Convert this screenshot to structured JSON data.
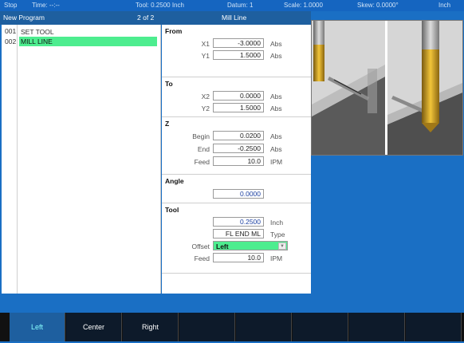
{
  "statusbar": {
    "state": "Stop",
    "time": "Time:  --:--",
    "tool": "Tool: 0.2500 Inch",
    "datum": "Datum: 1",
    "scale": "Scale: 1.0000",
    "skew": "Skew: 0.0000°",
    "units": "Inch"
  },
  "titlebar": {
    "program": "New Program",
    "page": "2 of 2",
    "step_title": "Mill Line"
  },
  "program_list": [
    {
      "num": "001",
      "label": "SET TOOL",
      "selected": false
    },
    {
      "num": "002",
      "label": "MILL LINE",
      "selected": true
    }
  ],
  "form": {
    "from": {
      "heading": "From",
      "x_label": "X1",
      "x_value": "-3.0000",
      "x_unit": "Abs",
      "y_label": "Y1",
      "y_value": "1.5000",
      "y_unit": "Abs"
    },
    "to": {
      "heading": "To",
      "x_label": "X2",
      "x_value": "0.0000",
      "x_unit": "Abs",
      "y_label": "Y2",
      "y_value": "1.5000",
      "y_unit": "Abs"
    },
    "z": {
      "heading": "Z",
      "begin_label": "Begin",
      "begin_value": "0.0200",
      "begin_unit": "Abs",
      "end_label": "End",
      "end_value": "-0.2500",
      "end_unit": "Abs",
      "feed_label": "Feed",
      "feed_value": "10.0",
      "feed_unit": "IPM"
    },
    "angle": {
      "heading": "Angle",
      "value": "0.0000"
    },
    "tool": {
      "heading": "Tool",
      "diameter_value": "0.2500",
      "diameter_unit": "Inch",
      "type_value": "FL END ML",
      "type_unit": "Type",
      "offset_label": "Offset",
      "offset_value": "Left",
      "feed_label": "Feed",
      "feed_value": "10.0",
      "feed_unit": "IPM"
    }
  },
  "softkeys": [
    "Left",
    "Center",
    "Right",
    "",
    "",
    "",
    "",
    ""
  ],
  "colors": {
    "accent": "#1e5f9f",
    "selection": "#4ded8f",
    "background": "#1a6fc4"
  }
}
